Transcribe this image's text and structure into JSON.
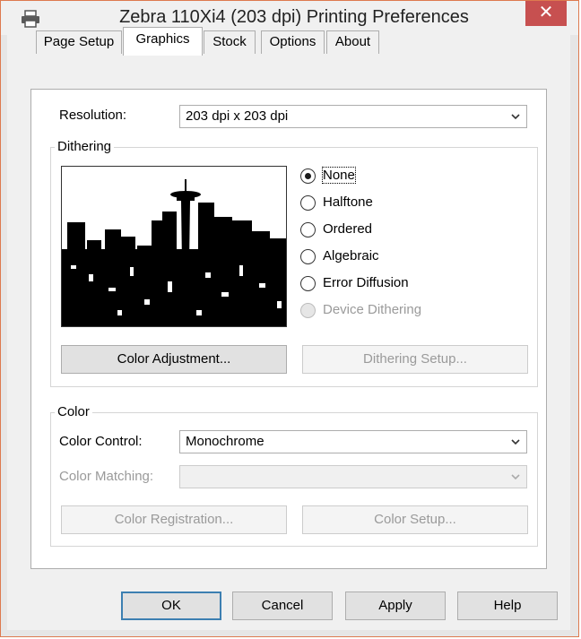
{
  "window": {
    "title": "Zebra 110Xi4 (203 dpi) Printing Preferences"
  },
  "tabs": [
    {
      "label": "Page Setup"
    },
    {
      "label": "Graphics"
    },
    {
      "label": "Stock"
    },
    {
      "label": "Options"
    },
    {
      "label": "About"
    }
  ],
  "resolution": {
    "label": "Resolution:",
    "value": "203 dpi x 203 dpi"
  },
  "dithering": {
    "title": "Dithering",
    "options": [
      {
        "label": "None",
        "selected": true,
        "enabled": true
      },
      {
        "label": "Halftone",
        "selected": false,
        "enabled": true
      },
      {
        "label": "Ordered",
        "selected": false,
        "enabled": true
      },
      {
        "label": "Algebraic",
        "selected": false,
        "enabled": true
      },
      {
        "label": "Error Diffusion",
        "selected": false,
        "enabled": true
      },
      {
        "label": "Device Dithering",
        "selected": false,
        "enabled": false
      }
    ],
    "color_adjustment_label": "Color Adjustment...",
    "dithering_setup_label": "Dithering Setup..."
  },
  "color": {
    "title": "Color",
    "control_label": "Color Control:",
    "control_value": "Monochrome",
    "matching_label": "Color Matching:",
    "matching_value": "",
    "registration_label": "Color Registration...",
    "setup_label": "Color Setup..."
  },
  "buttons": {
    "ok": "OK",
    "cancel": "Cancel",
    "apply": "Apply",
    "help": "Help"
  },
  "colors": {
    "close_button": "#c75050",
    "window_border": "#dd7a4f",
    "default_button_border": "#3c7fb1"
  },
  "icons": {
    "app": "printer-icon",
    "close": "close-icon",
    "dropdown": "chevron-down-icon"
  }
}
